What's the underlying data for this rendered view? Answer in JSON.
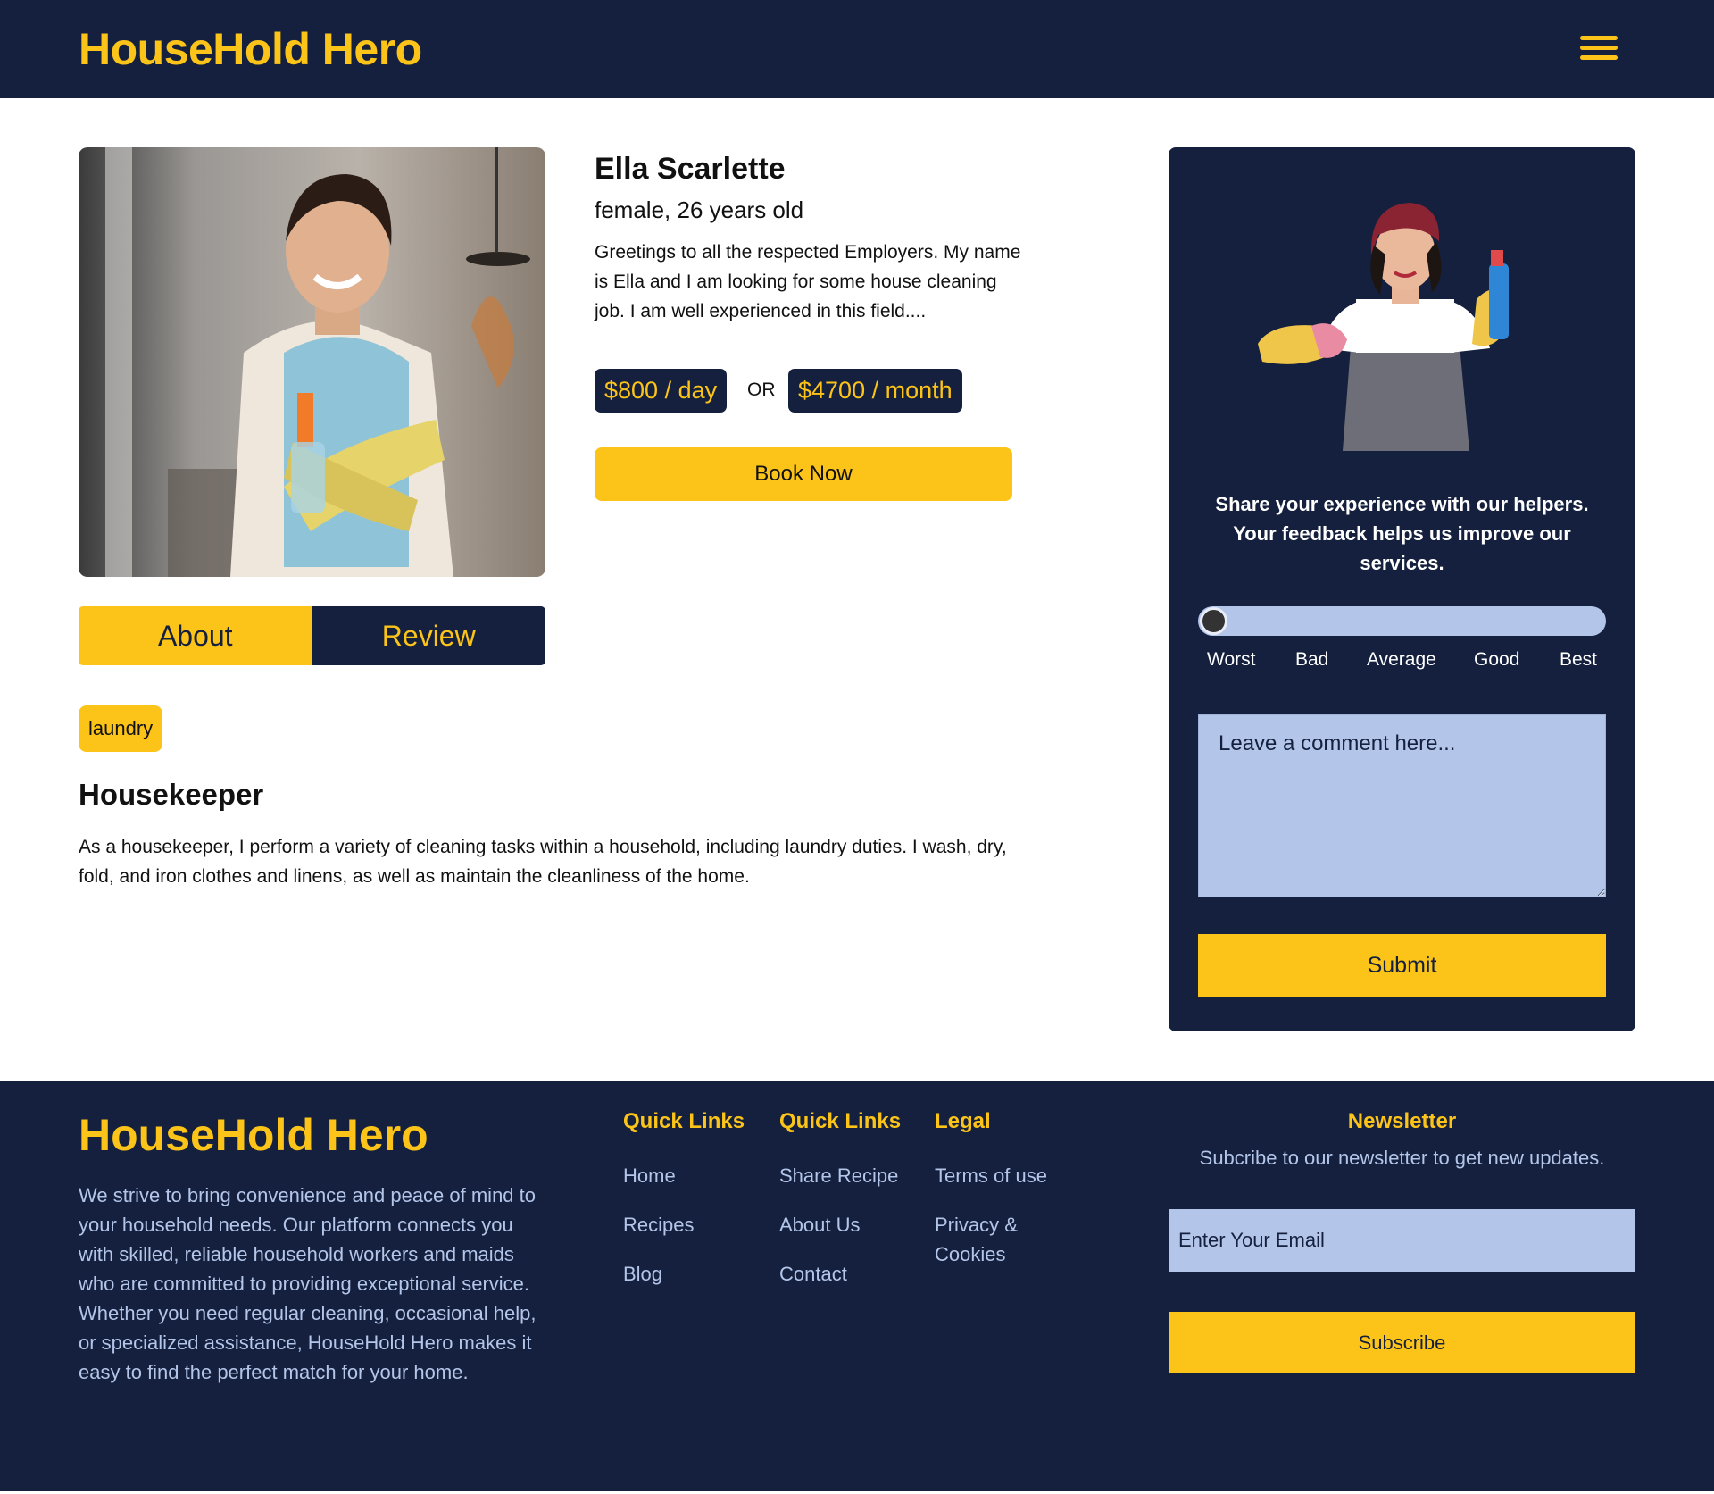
{
  "header": {
    "logo": "HouseHold Hero",
    "menu_icon": "hamburger-menu-icon"
  },
  "profile": {
    "name": "Ella Scarlette",
    "subtitle": "female, 26 years old",
    "bio": "Greetings to all the respected Employers. My name is Ella and I am looking for some house cleaning job. I am well experienced in this field....",
    "price_day": "$800 / day",
    "price_or": "OR",
    "price_month": "$4700 / month",
    "book_label": "Book Now"
  },
  "tabs": [
    {
      "label": "About",
      "active": true
    },
    {
      "label": "Review",
      "active": false
    }
  ],
  "about": {
    "tag": "laundry",
    "role": "Housekeeper",
    "description": "As a housekeeper, I perform a variety of cleaning tasks within a household, including laundry duties. I wash, dry, fold, and iron clothes and linens, as well as maintain the cleanliness of the home."
  },
  "feedback": {
    "text": "Share your experience with our helpers. Your feedback helps us improve our services.",
    "rating_value": 0,
    "scale": [
      "Worst",
      "Bad",
      "Average",
      "Good",
      "Best"
    ],
    "comment_placeholder": "Leave a comment here...",
    "submit_label": "Submit"
  },
  "footer": {
    "logo": "HouseHold Hero",
    "about": "We strive to bring convenience and peace of mind to your household needs. Our platform connects you with skilled, reliable household workers and maids who are committed to providing exceptional service. Whether you need regular cleaning, occasional help, or specialized assistance, HouseHold Hero makes it easy to find the perfect match for your home.",
    "columns": [
      {
        "title": "Quick Links",
        "links": [
          "Home",
          "Recipes",
          "Blog"
        ]
      },
      {
        "title": "Quick Links",
        "links": [
          "Share Recipe",
          "About Us",
          "Contact"
        ]
      },
      {
        "title": "Legal",
        "links": [
          "Terms of use",
          "Privacy & Cookies"
        ]
      }
    ],
    "newsletter": {
      "title": "Newsletter",
      "subtitle": "Subcribe to our newsletter to get new updates.",
      "email_placeholder": "Enter Your Email",
      "button_label": "Subscribe"
    }
  },
  "colors": {
    "navy": "#14203d",
    "accent": "#fcc419",
    "light": "#b4c5ea"
  }
}
